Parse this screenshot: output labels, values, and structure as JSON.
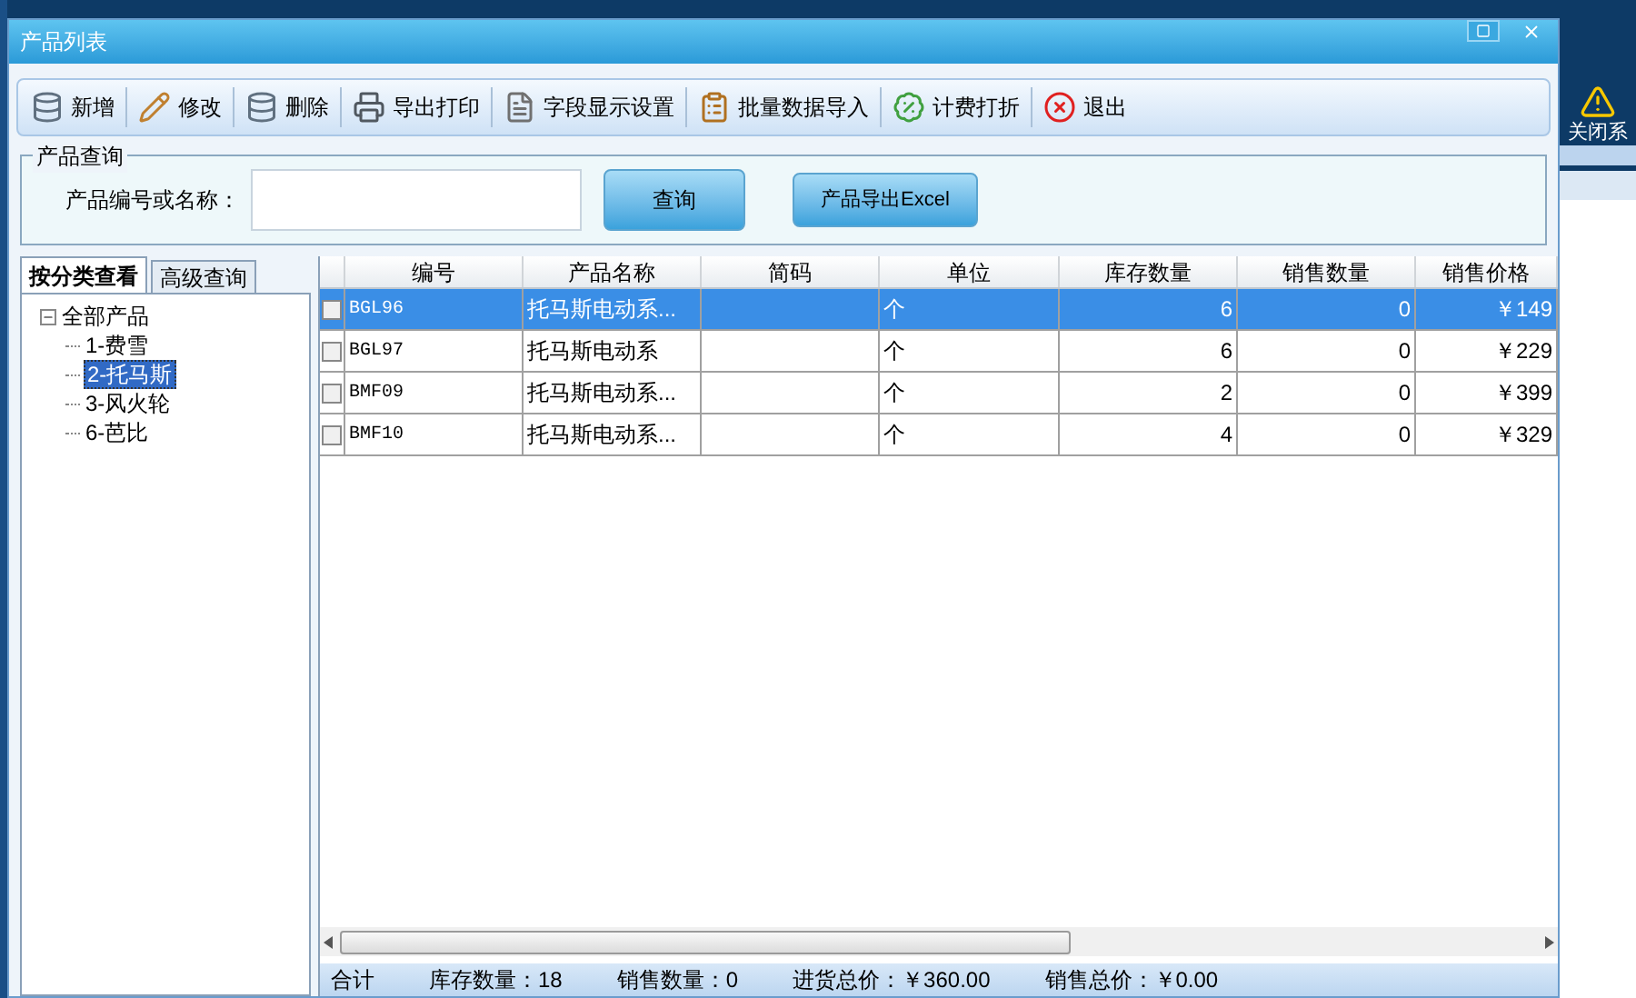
{
  "window": {
    "title": "产品列表"
  },
  "toolbar": [
    {
      "label": "新增",
      "kind": "add"
    },
    {
      "label": "修改",
      "kind": "edit"
    },
    {
      "label": "删除",
      "kind": "delete"
    },
    {
      "label": "导出打印",
      "kind": "print"
    },
    {
      "label": "字段显示设置",
      "kind": "fields"
    },
    {
      "label": "批量数据导入",
      "kind": "import"
    },
    {
      "label": "计费打折",
      "kind": "discount"
    },
    {
      "label": "退出",
      "kind": "exit"
    }
  ],
  "query": {
    "group_title": "产品查询",
    "label": "产品编号或名称：",
    "search_button": "查询",
    "export_button": "产品导出Excel"
  },
  "tabs": [
    {
      "label": "按分类查看",
      "selected": true
    },
    {
      "label": "高级查询",
      "selected": false
    }
  ],
  "tree": [
    {
      "label": "全部产品",
      "expanded": true,
      "selected": false,
      "children": [
        {
          "label": "1-费雪",
          "selected": false
        },
        {
          "label": "2-托马斯",
          "selected": true
        },
        {
          "label": "3-风火轮",
          "selected": false
        },
        {
          "label": "6-芭比",
          "selected": false
        }
      ]
    }
  ],
  "table": {
    "columns": [
      "编号",
      "产品名称",
      "简码",
      "单位",
      "库存数量",
      "销售数量",
      "销售价格"
    ],
    "rows": [
      {
        "selected": true,
        "checked": false,
        "cells": [
          "BGL96",
          "托马斯电动系...",
          "",
          "个",
          "6",
          "0",
          "￥149"
        ]
      },
      {
        "selected": false,
        "checked": false,
        "cells": [
          "BGL97",
          "托马斯电动系",
          "",
          "个",
          "6",
          "0",
          "￥229"
        ]
      },
      {
        "selected": false,
        "checked": false,
        "cells": [
          "BMF09",
          "托马斯电动系...",
          "",
          "个",
          "2",
          "0",
          "￥399"
        ]
      },
      {
        "selected": false,
        "checked": false,
        "cells": [
          "BMF10",
          "托马斯电动系...",
          "",
          "个",
          "4",
          "0",
          "￥329"
        ]
      }
    ]
  },
  "summary": [
    "合计",
    "库存数量：18",
    "销售数量：0",
    "进货总价：￥360.00",
    "销售总价：￥0.00"
  ],
  "desktop": {
    "notice_button": "关闭系"
  }
}
